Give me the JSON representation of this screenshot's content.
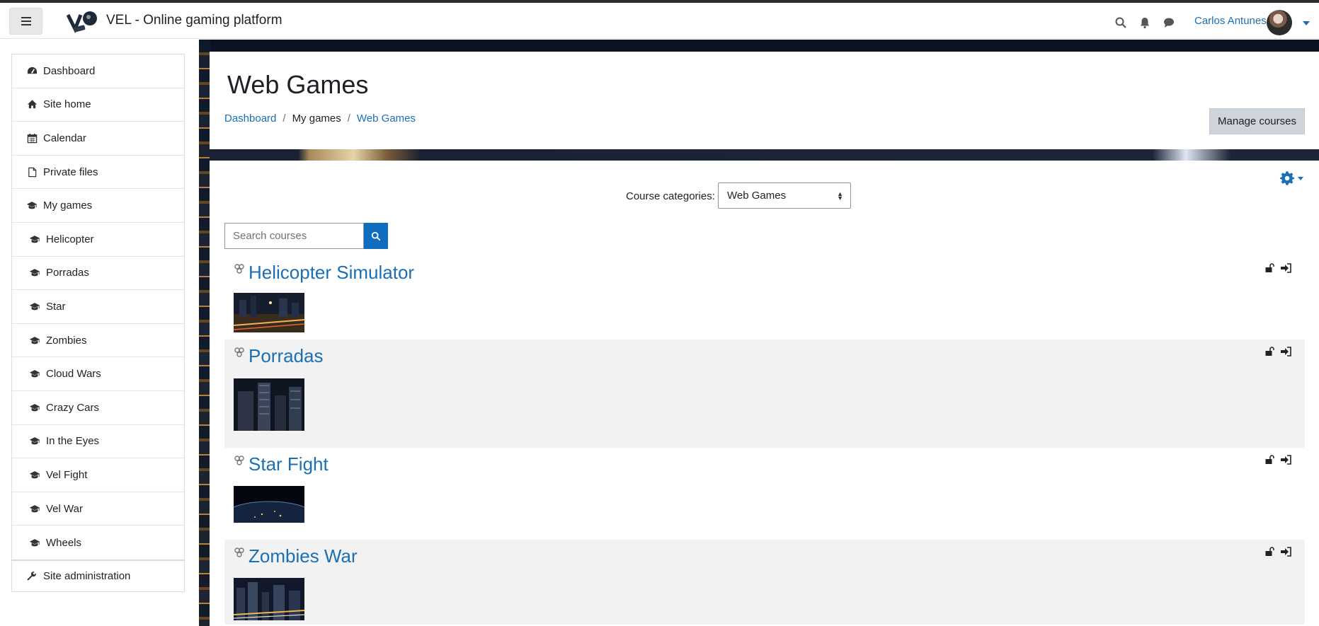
{
  "navbar": {
    "site_title": "VEL - Online gaming platform",
    "user_name": "Carlos Antunes",
    "icons": [
      "menu-icon",
      "search-icon",
      "bell-icon",
      "chat-icon",
      "caret-down-icon"
    ]
  },
  "sidebar": {
    "items": [
      {
        "label": "Dashboard",
        "icon": "dashboard-icon"
      },
      {
        "label": "Site home",
        "icon": "home-icon"
      },
      {
        "label": "Calendar",
        "icon": "calendar-icon"
      },
      {
        "label": "Private files",
        "icon": "file-icon"
      },
      {
        "label": "My games",
        "icon": "graduation-cap-icon"
      },
      {
        "label": "Helicopter",
        "icon": "graduation-cap-icon"
      },
      {
        "label": "Porradas",
        "icon": "graduation-cap-icon"
      },
      {
        "label": "Star",
        "icon": "graduation-cap-icon"
      },
      {
        "label": "Zombies",
        "icon": "graduation-cap-icon"
      },
      {
        "label": "Cloud Wars",
        "icon": "graduation-cap-icon"
      },
      {
        "label": "Crazy Cars",
        "icon": "graduation-cap-icon"
      },
      {
        "label": "In the Eyes",
        "icon": "graduation-cap-icon"
      },
      {
        "label": "Vel Fight",
        "icon": "graduation-cap-icon"
      },
      {
        "label": "Vel War",
        "icon": "graduation-cap-icon"
      },
      {
        "label": "Wheels",
        "icon": "graduation-cap-icon"
      }
    ],
    "admin_label": "Site administration"
  },
  "header": {
    "title": "Web Games",
    "breadcrumb": [
      "Dashboard",
      "My games",
      "Web Games"
    ],
    "manage_button": "Manage courses"
  },
  "main": {
    "category_label": "Course categories:",
    "category_selected": "Web Games",
    "search_placeholder": "Search courses",
    "courses": [
      {
        "name": "Helicopter Simulator"
      },
      {
        "name": "Porradas"
      },
      {
        "name": "Star Fight"
      },
      {
        "name": "Zombies War"
      }
    ]
  },
  "colors": {
    "link": "#1a6fb5",
    "primary_button": "#0f6cbf",
    "secondary_button": "#ced4da",
    "stripe": "#f2f2f2"
  }
}
